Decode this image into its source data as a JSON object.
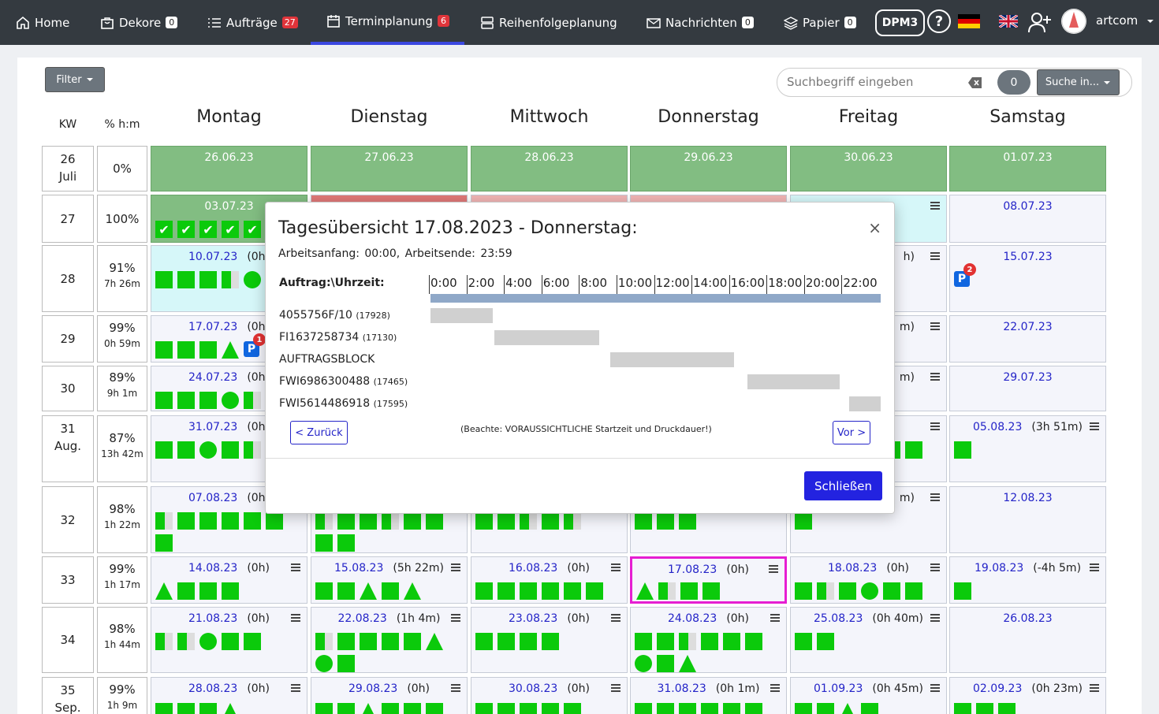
{
  "nav": {
    "home": "Home",
    "dekore": "Dekore",
    "dekore_count": "0",
    "auftraege": "Aufträge",
    "auftraege_count": "27",
    "terminplanung": "Terminplanung",
    "terminplanung_count": "6",
    "reihenfolge": "Reihenfolgeplanung",
    "nachrichten": "Nachrichten",
    "nachrichten_count": "0",
    "papier": "Papier",
    "papier_count": "0",
    "dpm": "DPM3",
    "help": "?",
    "user": "artcom"
  },
  "toolbar": {
    "filter": "Filter",
    "search_placeholder": "Suchbegriff eingeben",
    "search_count": "0",
    "search_in": "Suche in..."
  },
  "headers": {
    "kw": "KW",
    "pct": "% h:m",
    "days": [
      "Montag",
      "Dienstag",
      "Mittwoch",
      "Donnerstag",
      "Freitag",
      "Samstag"
    ]
  },
  "weeks": [
    {
      "kw": "26",
      "sub": "Juli",
      "pct": "0%",
      "hm": "",
      "days": [
        {
          "date": "26.06.23",
          "past": true
        },
        {
          "date": "27.06.23",
          "past": true
        },
        {
          "date": "28.06.23",
          "past": true
        },
        {
          "date": "29.06.23",
          "past": true
        },
        {
          "date": "30.06.23",
          "past": true
        },
        {
          "date": "01.07.23",
          "past": true
        }
      ]
    },
    {
      "kw": "27",
      "sub": "",
      "pct": "100%",
      "hm": "",
      "days": [
        {
          "date": "03.07.23",
          "past": true,
          "marks": "ck,ck,ck,ck,ck"
        },
        {
          "date": "",
          "strip": "#e07878"
        },
        {
          "date": "",
          "strip": "#f0b4b4"
        },
        {
          "date": "",
          "strip": "#f0b4b4"
        },
        {
          "date": "",
          "cyan": true,
          "menu": true
        },
        {
          "date": "08.07.23"
        }
      ]
    },
    {
      "kw": "28",
      "sub": "",
      "pct": "91%",
      "hm": "7h 26m",
      "days": [
        {
          "date": "10.07.23",
          "hours": "(0h)",
          "cyan": true,
          "marks": "sq,sq,sq,half,ci"
        },
        {
          "date": ""
        },
        {
          "date": ""
        },
        {
          "date": ""
        },
        {
          "date": "",
          "suffix": "h)",
          "menu": true
        },
        {
          "date": "15.07.23",
          "marks": "p2"
        }
      ]
    },
    {
      "kw": "29",
      "sub": "",
      "pct": "99%",
      "hm": "0h 59m",
      "days": [
        {
          "date": "17.07.23",
          "hours": "(0h)",
          "marks": "sq,sq,sq,tri,p1"
        },
        {
          "date": ""
        },
        {
          "date": ""
        },
        {
          "date": ""
        },
        {
          "date": "",
          "suffix": "m)",
          "menu": true
        },
        {
          "date": "22.07.23"
        }
      ]
    },
    {
      "kw": "30",
      "sub": "",
      "pct": "89%",
      "hm": "9h 1m",
      "days": [
        {
          "date": "24.07.23",
          "hours": "(0h)",
          "marks": "sq,sq,sq,ci,half"
        },
        {
          "date": ""
        },
        {
          "date": ""
        },
        {
          "date": ""
        },
        {
          "date": "",
          "suffix": "m)",
          "menu": true
        },
        {
          "date": "29.07.23"
        }
      ]
    },
    {
      "kw": "31",
      "sub": "Aug.",
      "pct": "87%",
      "hm": "13h 42m",
      "days": [
        {
          "date": "31.07.23",
          "hours": "(0h)",
          "marks": "sq,sq,ci,sq,half"
        },
        {
          "date": ""
        },
        {
          "date": ""
        },
        {
          "date": ""
        },
        {
          "date": "",
          "menu": true,
          "marks": "pad,pad,pad,pad,sq,sq,sq"
        },
        {
          "date": "05.08.23",
          "hours": "(3h 51m)",
          "menu": true,
          "marks": "sq"
        }
      ]
    },
    {
      "kw": "32",
      "sub": "",
      "pct": "98%",
      "hm": "1h 22m",
      "days": [
        {
          "date": "07.08.23",
          "hours": "(0h)",
          "marks": "half,sq,sq,sq,sq,sq,sq"
        },
        {
          "date": "",
          "marks": "half,sq,sq,half,sq,sq,sq,sq"
        },
        {
          "date": "",
          "marks": "sq,sq,half,sq,half"
        },
        {
          "date": "",
          "marks": "sq,sq,sq"
        },
        {
          "date": "",
          "suffix": "m)",
          "menu": true,
          "marks": "sq"
        },
        {
          "date": "12.08.23"
        }
      ]
    },
    {
      "kw": "33",
      "sub": "",
      "pct": "99%",
      "hm": "1h 17m",
      "days": [
        {
          "date": "14.08.23",
          "hours": "(0h)",
          "menu": true,
          "marks": "tri,sq,sq,sq"
        },
        {
          "date": "15.08.23",
          "hours": "(5h 22m)",
          "menu": true,
          "marks": "sq,sq,tri,sq,tri"
        },
        {
          "date": "16.08.23",
          "hours": "(0h)",
          "menu": true,
          "marks": "sq,sq,sq,sq,sq,sq"
        },
        {
          "date": "17.08.23",
          "hours": "(0h)",
          "menu": true,
          "sel": true,
          "marks": "tri,half,sq,sq"
        },
        {
          "date": "18.08.23",
          "hours": "(0h)",
          "menu": true,
          "marks": "sq,half,sq,ci,sq,sq,sq"
        },
        {
          "date": "19.08.23",
          "hours": "(-4h 5m)",
          "menu": true,
          "marks": "sq"
        }
      ]
    },
    {
      "kw": "34",
      "sub": "",
      "pct": "98%",
      "hm": "1h 44m",
      "days": [
        {
          "date": "21.08.23",
          "hours": "(0h)",
          "menu": true,
          "marks": "half,half,ci,sq,sq"
        },
        {
          "date": "22.08.23",
          "hours": "(1h 4m)",
          "menu": true,
          "marks": "half,sq,sq,sq,sq,tri,ci,sq"
        },
        {
          "date": "23.08.23",
          "hours": "(0h)",
          "menu": true,
          "marks": "sq,sq,sq,sq"
        },
        {
          "date": "24.08.23",
          "hours": "(0h)",
          "menu": true,
          "marks": "sq,sq,half,sq,sq,sq,ci,sq,tri"
        },
        {
          "date": "25.08.23",
          "hours": "(0h 40m)",
          "menu": true,
          "marks": "sq,sq"
        },
        {
          "date": "26.08.23"
        }
      ]
    },
    {
      "kw": "35",
      "sub": "Sep.",
      "pct": "99%",
      "hm": "1h 9m",
      "days": [
        {
          "date": "28.08.23",
          "hours": "(0h)",
          "menu": true,
          "marks": "sq,sq,sq,tri"
        },
        {
          "date": "29.08.23",
          "hours": "(0h)",
          "menu": true,
          "marks": "sq,sq,tri,sq,sq,sq,sq,sq"
        },
        {
          "date": "30.08.23",
          "hours": "(0h)",
          "menu": true,
          "marks": "sq,sq,sq,sq,sq"
        },
        {
          "date": "31.08.23",
          "hours": "(0h 1m)",
          "menu": true,
          "marks": "sq,sq,sq,sq,sq,sq,sq"
        },
        {
          "date": "01.09.23",
          "hours": "(0h 45m)",
          "menu": true,
          "marks": "sq,sq,tri,sq"
        },
        {
          "date": "02.09.23",
          "hours": "(0h 23m)",
          "menu": true,
          "marks": "sq,sq,sq"
        }
      ]
    }
  ],
  "modal": {
    "title": "Tagesübersicht 17.08.2023 - Donnerstag:",
    "close": "×",
    "start_label": "Arbeitsanfang: 00:00,",
    "end_label": "Arbeitsende: 23:59",
    "header": "Auftrag:\\Uhrzeit:",
    "ticks": [
      "0:00",
      "2:00",
      "4:00",
      "6:00",
      "8:00",
      "10:00",
      "12:00",
      "14:00",
      "16:00",
      "18:00",
      "20:00",
      "22:00"
    ],
    "jobs": [
      {
        "name": "4055756F/10",
        "id": "(17928)",
        "start": 0.0,
        "end": 3.3
      },
      {
        "name": "FI1637258734",
        "id": "(17130)",
        "start": 3.4,
        "end": 9.0
      },
      {
        "name": "AUFTRAGSBLOCK",
        "id": "",
        "start": 9.6,
        "end": 16.2
      },
      {
        "name": "FWI6986300488",
        "id": "(17465)",
        "start": 16.9,
        "end": 21.8
      },
      {
        "name": "FWI5614486918",
        "id": "(17595)",
        "start": 22.3,
        "end": 24.0
      }
    ],
    "back": "< Zurück",
    "note": "(Beachte: VORAUSSICHTLICHE Startzeit und Druckdauer!)",
    "next": "Vor >",
    "ok": "Schließen"
  },
  "colors": {
    "navbar": "#343a40",
    "accent": "#2323e0",
    "mark": "#0bca0b",
    "past": "#82bd82",
    "selected": "#e61ed2"
  }
}
